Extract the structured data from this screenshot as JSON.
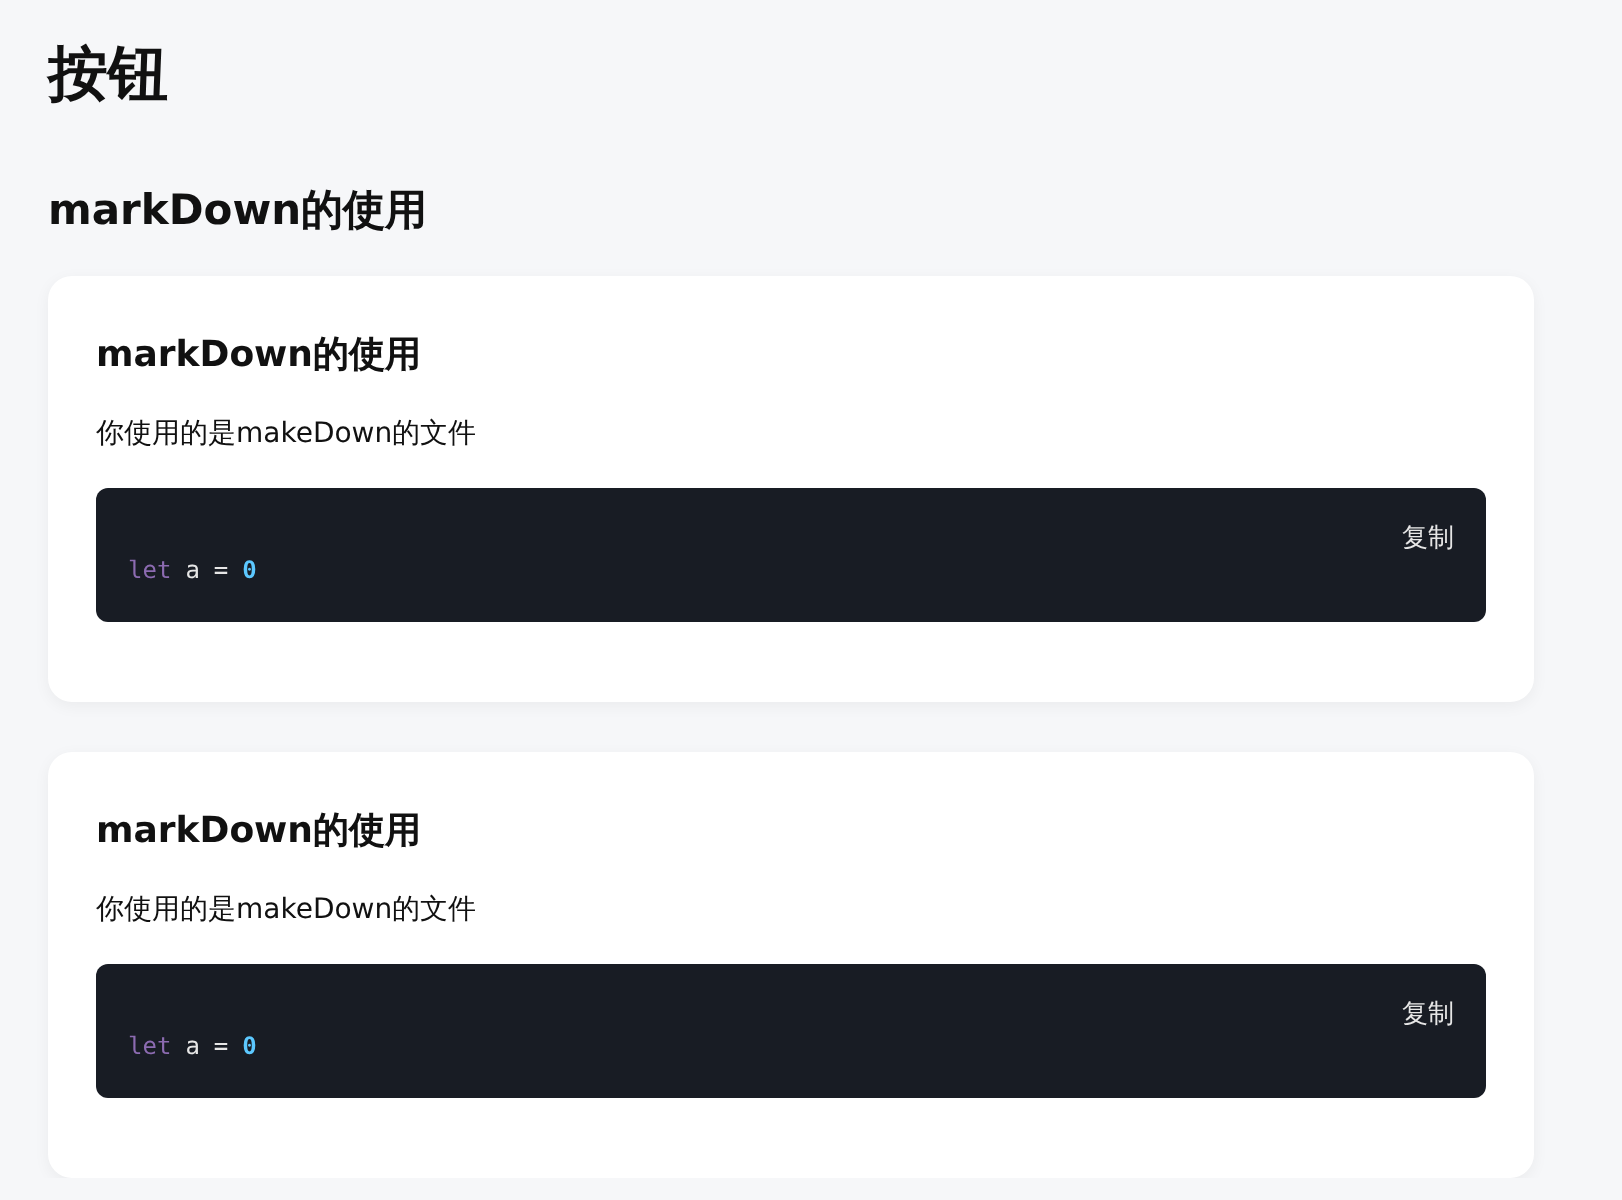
{
  "title": "按钮",
  "section_title": "markDown的使用",
  "cards": [
    {
      "heading": "markDown的使用",
      "text": "你使用的是makeDown的文件",
      "copy_button": "复制",
      "code": [
        {
          "kind": "keyword",
          "text": "let"
        },
        {
          "kind": "plain",
          "text": "a"
        },
        {
          "kind": "operator",
          "text": "="
        },
        {
          "kind": "number",
          "text": "0"
        }
      ]
    },
    {
      "heading": "markDown的使用",
      "text": "你使用的是makeDown的文件",
      "copy_button": "复制",
      "code": [
        {
          "kind": "keyword",
          "text": "let"
        },
        {
          "kind": "plain",
          "text": "a"
        },
        {
          "kind": "operator",
          "text": "="
        },
        {
          "kind": "number",
          "text": "0"
        }
      ]
    }
  ]
}
